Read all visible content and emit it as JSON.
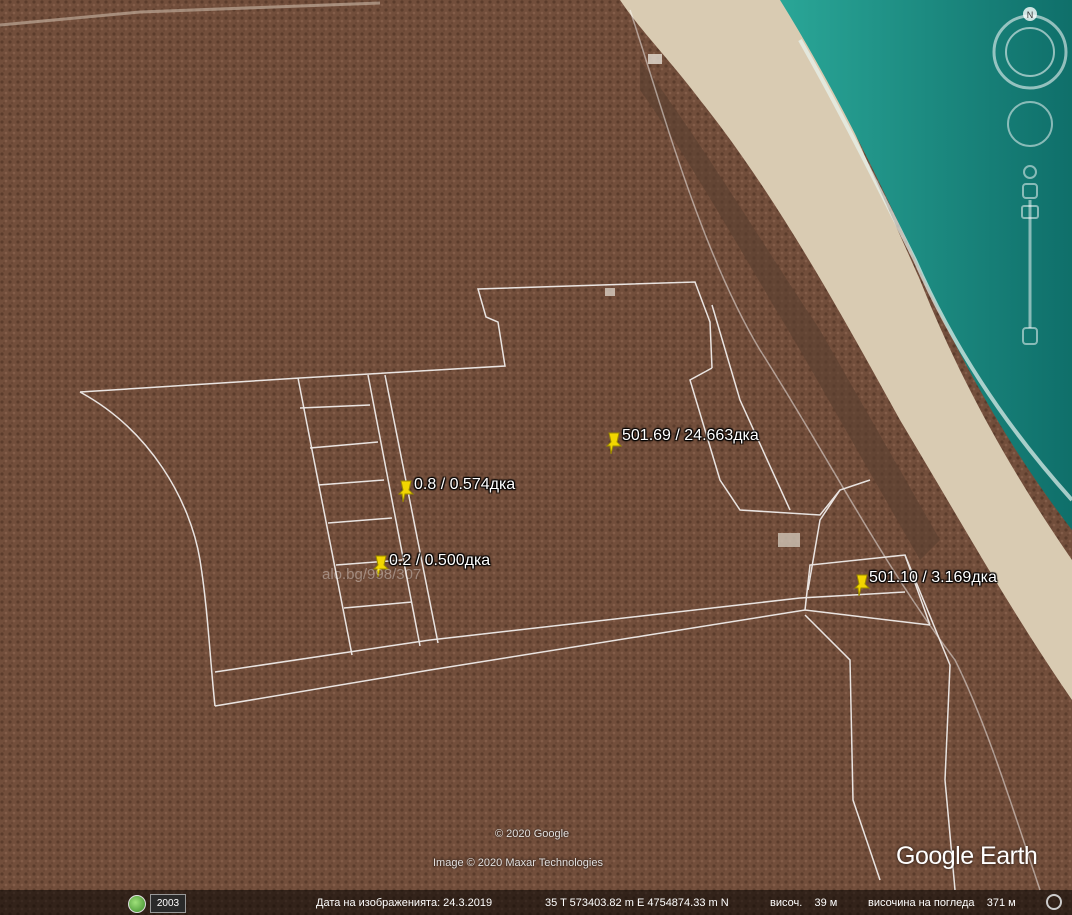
{
  "map": {
    "pins": [
      {
        "label": "501.69 / 24.663дка"
      },
      {
        "label": "0.8 / 0.574дка"
      },
      {
        "label": "0.2 / 0.500дка"
      },
      {
        "label": "501.10 / 3.169дка"
      }
    ],
    "watermark": "alo.bg/998/307",
    "copyright": "© 2020 Google",
    "imagery_credit": "Image © 2020 Maxar Technologies",
    "logo": "Google Earth",
    "compass_label": "N"
  },
  "statusbar": {
    "history_year": "2003",
    "imagery_date": "Дата на изображенията: 24.3.2019",
    "coordinates": "35 T 573403.82 m E 4754874.33 m N",
    "elevation": "височ.    39 м",
    "eye_altitude": "височина на погледа    371 м"
  },
  "colors": {
    "terrain": "#7a5440",
    "sea": "#1f9e8f",
    "beach": "#d9cbb2",
    "parcel_lines": "#ffffff",
    "pin": "#f2d600"
  }
}
